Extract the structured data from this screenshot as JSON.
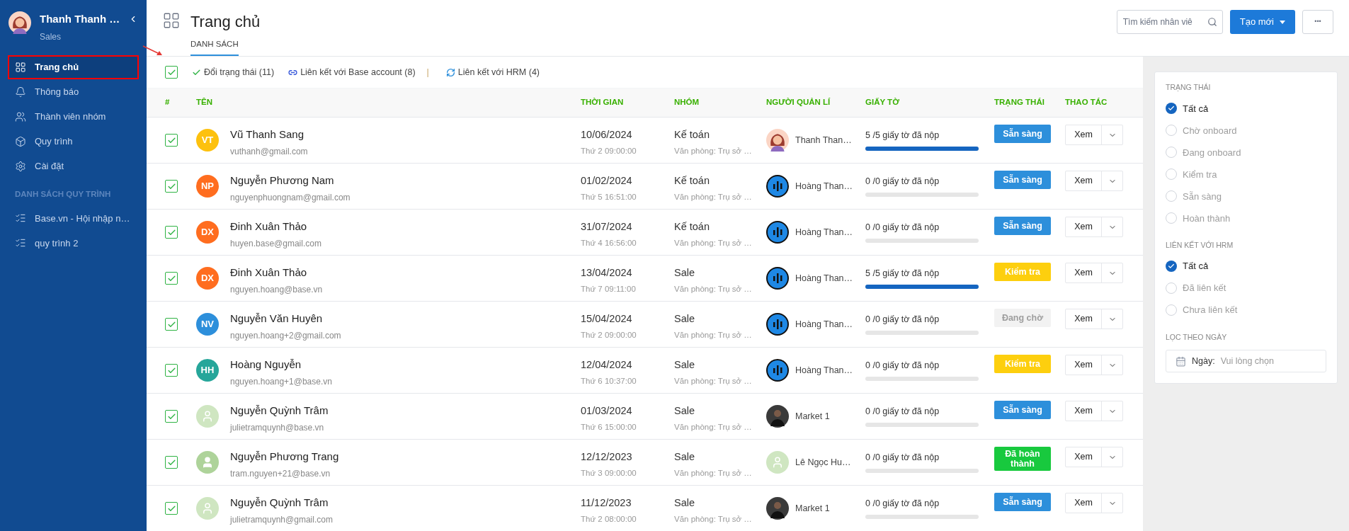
{
  "sidebar": {
    "user": {
      "name": "Thanh Thanh …",
      "role": "Sales"
    },
    "items": [
      {
        "label": "Trang chủ",
        "selected": true,
        "highlighted": true
      },
      {
        "label": "Thông báo",
        "selected": false,
        "highlighted": false
      },
      {
        "label": "Thành viên nhóm",
        "selected": false,
        "highlighted": false
      },
      {
        "label": "Quy trình",
        "selected": false,
        "highlighted": false
      },
      {
        "label": "Cài đặt",
        "selected": false,
        "highlighted": false
      }
    ],
    "section_title": "DANH SÁCH QUY TRÌNH",
    "workflows": [
      {
        "label": "Base.vn - Hội nhập n…"
      },
      {
        "label": "quy trình 2"
      }
    ]
  },
  "header": {
    "title": "Trang chủ",
    "tabs": [
      {
        "label": "DANH SÁCH",
        "selected": true
      }
    ],
    "search": {
      "placeholder": "Tìm kiếm nhân viê"
    },
    "create_button": "Tạo mới",
    "more_button": "•••"
  },
  "toolbar": {
    "select_all": {
      "checked": true
    },
    "actions": [
      {
        "kind": "check",
        "label": "Đổi trạng thái (11)"
      },
      {
        "kind": "link",
        "label": "Liên kết với Base account (8)"
      },
      {
        "kind": "sync",
        "label": "Liên kết với HRM (4)"
      }
    ],
    "separator": "|"
  },
  "annotation": {
    "kind": "arrow"
  },
  "table": {
    "columns": [
      "#",
      "TÊN",
      "THỜI GIAN",
      "NHÓM",
      "NGƯỜI QUẢN LÍ",
      "GIẤY TỜ",
      "TRẠNG THÁI",
      "THAO TÁC"
    ],
    "rows": [
      {
        "checked": true,
        "avatar": {
          "kind": "initials",
          "text": "VT",
          "color": "#fdc10e"
        },
        "name": "Vũ Thanh Sang",
        "email": "vuthanh@gmail.com",
        "date": "10/06/2024",
        "time": "Thứ 2 09:00:00",
        "group": "Kế toán",
        "office": "Văn phòng: Trụ sở …",
        "manager": {
          "kind": "cartoon",
          "name": "Thanh Than…"
        },
        "docs": "5 /5 giấy tờ đã nộp",
        "level": 1,
        "status": {
          "kind": "ready",
          "label": "Sẵn sàng"
        },
        "view": "Xem"
      },
      {
        "checked": true,
        "avatar": {
          "kind": "initials",
          "text": "NP",
          "color": "#ff6d1f"
        },
        "name": "Nguyễn Phương Nam",
        "email": "nguyenphuongnam@gmail.com",
        "date": "01/02/2024",
        "time": "Thứ 5 16:51:00",
        "group": "Kế toán",
        "office": "Văn phòng: Trụ sở …",
        "manager": {
          "kind": "logo",
          "name": "Hoàng Than…"
        },
        "docs": "0 /0 giấy tờ đã nộp",
        "level": 0,
        "status": {
          "kind": "ready",
          "label": "Sẵn sàng"
        },
        "view": "Xem"
      },
      {
        "checked": true,
        "avatar": {
          "kind": "initials",
          "text": "DX",
          "color": "#ff6d1f"
        },
        "name": "Đinh Xuân Thảo",
        "email": "huyen.base@gmail.com",
        "date": "31/07/2024",
        "time": "Thứ 4 16:56:00",
        "group": "Kế toán",
        "office": "Văn phòng: Trụ sở …",
        "manager": {
          "kind": "logo",
          "name": "Hoàng Than…"
        },
        "docs": "0 /0 giấy tờ đã nộp",
        "level": 0,
        "status": {
          "kind": "ready",
          "label": "Sẵn sàng"
        },
        "view": "Xem"
      },
      {
        "checked": true,
        "avatar": {
          "kind": "initials",
          "text": "DX",
          "color": "#ff6d1f"
        },
        "name": "Đinh Xuân Thảo",
        "email": "nguyen.hoang@base.vn",
        "date": "13/04/2024",
        "time": "Thứ 7 09:11:00",
        "group": "Sale",
        "office": "Văn phòng: Trụ sở …",
        "manager": {
          "kind": "logo",
          "name": "Hoàng Than…"
        },
        "docs": "5 /5 giấy tờ đã nộp",
        "level": 1,
        "status": {
          "kind": "check",
          "label": "Kiểm tra"
        },
        "view": "Xem"
      },
      {
        "checked": true,
        "avatar": {
          "kind": "initials",
          "text": "NV",
          "color": "#2d8fdb"
        },
        "name": "Nguyễn Văn Huyên",
        "email": "nguyen.hoang+2@gmail.com",
        "date": "15/04/2024",
        "time": "Thứ 2 09:00:00",
        "group": "Sale",
        "office": "Văn phòng: Trụ sở …",
        "manager": {
          "kind": "logo",
          "name": "Hoàng Than…"
        },
        "docs": "0 /0 giấy tờ đã nộp",
        "level": 0,
        "status": {
          "kind": "waiting",
          "label": "Đang chờ"
        },
        "view": "Xem"
      },
      {
        "checked": true,
        "avatar": {
          "kind": "initials",
          "text": "HH",
          "color": "#26a69a"
        },
        "name": "Hoàng Nguyễn",
        "email": "nguyen.hoang+1@base.vn",
        "date": "12/04/2024",
        "time": "Thứ 6 10:37:00",
        "group": "Sale",
        "office": "Văn phòng: Trụ sở …",
        "manager": {
          "kind": "logo",
          "name": "Hoàng Than…"
        },
        "docs": "0 /0 giấy tờ đã nộp",
        "level": 0,
        "status": {
          "kind": "check",
          "label": "Kiểm tra"
        },
        "view": "Xem"
      },
      {
        "checked": true,
        "avatar": {
          "kind": "outline"
        },
        "name": "Nguyễn Quỳnh Trâm",
        "email": "julietramquynh@base.vn",
        "date": "01/03/2024",
        "time": "Thứ 6 15:00:00",
        "group": "Sale",
        "office": "Văn phòng: Trụ sở …",
        "manager": {
          "kind": "photo",
          "name": "Market 1"
        },
        "docs": "0 /0 giấy tờ đã nộp",
        "level": 0,
        "status": {
          "kind": "ready",
          "label": "Sẵn sàng"
        },
        "view": "Xem"
      },
      {
        "checked": true,
        "avatar": {
          "kind": "filled"
        },
        "name": "Nguyễn Phương Trang",
        "email": "tram.nguyen+21@base.vn",
        "date": "12/12/2023",
        "time": "Thứ 3 09:00:00",
        "group": "Sale",
        "office": "Văn phòng: Trụ sở …",
        "manager": {
          "kind": "outline",
          "name": "Lê Ngọc Hu…"
        },
        "docs": "0 /0 giấy tờ đã nộp",
        "level": 0,
        "status": {
          "kind": "done",
          "label": "Đã hoàn thành"
        },
        "view": "Xem"
      },
      {
        "checked": true,
        "avatar": {
          "kind": "outline"
        },
        "name": "Nguyễn Quỳnh Trâm",
        "email": "julietramquynh@gmail.com",
        "date": "11/12/2023",
        "time": "Thứ 2 08:00:00",
        "group": "Sale",
        "office": "Văn phòng: Trụ sở …",
        "manager": {
          "kind": "photo",
          "name": "Market 1"
        },
        "docs": "0 /0 giấy tờ đã nộp",
        "level": 0,
        "status": {
          "kind": "ready",
          "label": "Sẵn sàng"
        },
        "view": "Xem"
      }
    ]
  },
  "filters": {
    "status": {
      "title": "TRẠNG THÁI",
      "options": [
        {
          "label": "Tất cả",
          "selected": true
        },
        {
          "label": "Chờ onboard",
          "selected": false
        },
        {
          "label": "Đang onboard",
          "selected": false
        },
        {
          "label": "Kiểm tra",
          "selected": false
        },
        {
          "label": "Sẵn sàng",
          "selected": false
        },
        {
          "label": "Hoàn thành",
          "selected": false
        }
      ]
    },
    "hrm": {
      "title": "LIÊN KẾT VỚI HRM",
      "options": [
        {
          "label": "Tất cả",
          "selected": true
        },
        {
          "label": "Đã liên kết",
          "selected": false
        },
        {
          "label": "Chưa liên kết",
          "selected": false
        }
      ]
    },
    "date": {
      "title": "LỌC THEO NGÀY",
      "label": "Ngày:",
      "placeholder": "Vui lòng chọn"
    }
  }
}
